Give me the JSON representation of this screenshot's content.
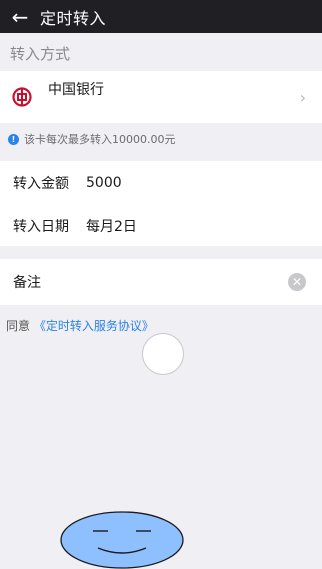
{
  "header": {
    "back_icon": "arrow-left-icon",
    "title": "定时转入"
  },
  "section": {
    "label": "转入方式"
  },
  "bank": {
    "name": "中国银行",
    "icon": "bank-of-china-icon",
    "brand_color": "#c8102e"
  },
  "hint": {
    "text": "该卡每次最多转入10000.00元"
  },
  "amount": {
    "label": "转入金额",
    "value": "5000"
  },
  "date": {
    "label": "转入日期",
    "value": "每月2日"
  },
  "note": {
    "label": "备注",
    "value": ""
  },
  "agreement": {
    "prefix": "同意",
    "link": "《定时转入服务协议》"
  },
  "colors": {
    "accent": "#2a83e6",
    "header_bg": "#1f1f24",
    "redaction_fill": "#8ec0ff"
  }
}
